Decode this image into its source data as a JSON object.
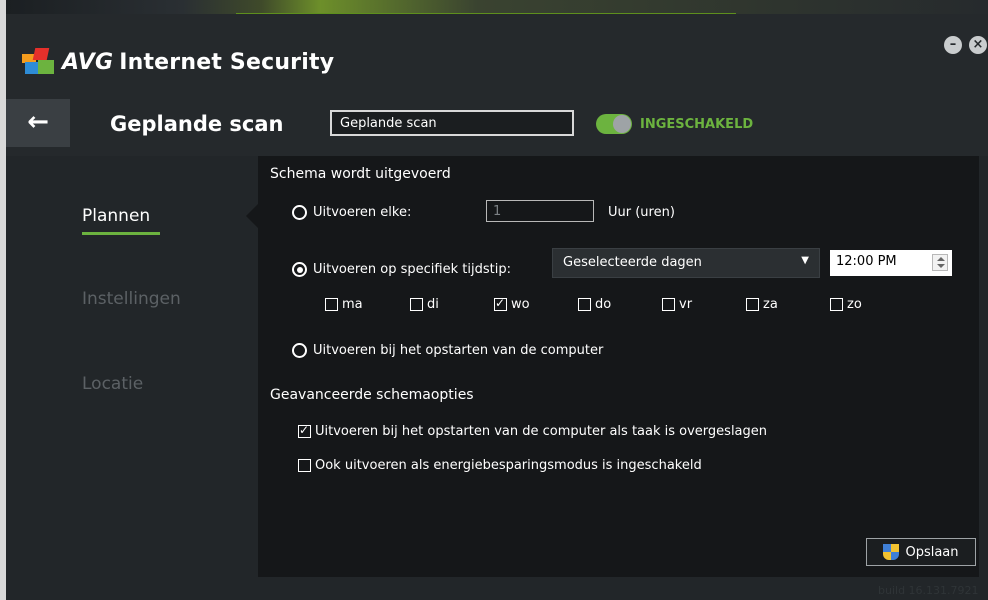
{
  "app": {
    "brand": "AVG",
    "product": "Internet Security"
  },
  "window_controls": {
    "minimize": "–",
    "close": "×"
  },
  "titlebar": {
    "back": "←",
    "title": "Geplande scan",
    "name_value": "Geplande scan",
    "toggle_label": "INGESCHAKELD",
    "toggle_on": true
  },
  "sidebar": {
    "items": [
      {
        "label": "Plannen",
        "active": true
      },
      {
        "label": "Instellingen",
        "active": false
      },
      {
        "label": "Locatie",
        "active": false
      }
    ]
  },
  "schedule": {
    "section_title": "Schema wordt uitgevoerd",
    "option_every": "Uitvoeren elke:",
    "interval_value": "1",
    "interval_unit": "Uur (uren)",
    "option_specific": "Uitvoeren op specifiek tijdstip:",
    "days_select": "Geselecteerde dagen",
    "select_arrow": "▼",
    "time_value": "12:00 PM",
    "days": [
      {
        "label": "ma",
        "checked": false
      },
      {
        "label": "di",
        "checked": false
      },
      {
        "label": "wo",
        "checked": true
      },
      {
        "label": "do",
        "checked": false
      },
      {
        "label": "vr",
        "checked": false
      },
      {
        "label": "za",
        "checked": false
      },
      {
        "label": "zo",
        "checked": false
      }
    ],
    "option_startup": "Uitvoeren bij het opstarten van de computer",
    "selected_option": "specific"
  },
  "advanced": {
    "section_title": "Geavanceerde schemaopties",
    "run_if_missed": "Uitvoeren bij het opstarten van de computer als taak is overgeslagen",
    "run_if_missed_checked": true,
    "run_power_saving": "Ook uitvoeren als energiebesparingsmodus is ingeschakeld",
    "run_power_saving_checked": false
  },
  "footer": {
    "save_label": "Opslaan",
    "build": "build 16.131.7921"
  },
  "colors": {
    "accent_green": "#6cb33f",
    "panel_bg": "#151719",
    "window_bg": "#222629"
  }
}
